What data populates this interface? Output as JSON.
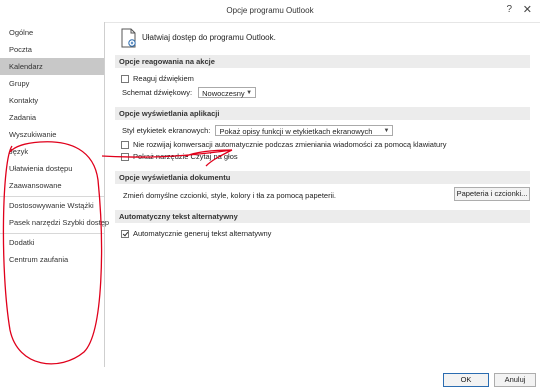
{
  "window": {
    "title": "Opcje programu Outlook",
    "help_glyph": "?",
    "close_glyph": "✕"
  },
  "sidebar": {
    "items": [
      {
        "label": "Ogólne"
      },
      {
        "label": "Poczta"
      },
      {
        "label": "Kalendarz"
      },
      {
        "label": "Grupy"
      },
      {
        "label": "Kontakty"
      },
      {
        "label": "Zadania"
      },
      {
        "label": "Wyszukiwanie"
      },
      {
        "label": "Język"
      },
      {
        "label": "Ułatwienia dostępu"
      },
      {
        "label": "Zaawansowane"
      },
      {
        "label": "Dostosowywanie Wstążki"
      },
      {
        "label": "Pasek narzędzi Szybki dostęp"
      },
      {
        "label": "Dodatki"
      },
      {
        "label": "Centrum zaufania"
      }
    ]
  },
  "main": {
    "header": "Ułatwiaj dostęp do programu Outlook.",
    "sections": {
      "reaction": {
        "title": "Opcje reagowania na akcje",
        "sound_label": "Reaguj dźwiękiem",
        "sound_checked": false,
        "scheme_label": "Schemat dźwiękowy:",
        "scheme_value": "Nowoczesny"
      },
      "display": {
        "title": "Opcje wyświetlania aplikacji",
        "tooltip_label": "Styl etykietek ekranowych:",
        "tooltip_value": "Pokaż opisy funkcji w etykietkach ekranowych",
        "no_collapse_label": "Nie rozwijaj konwersacji automatycznie podczas zmieniania wiadomości za pomocą klawiatury",
        "no_collapse_checked": false,
        "read_aloud_label": "Pokaż narzędzie Czytaj na głos",
        "read_aloud_checked": false
      },
      "document": {
        "title": "Opcje wyświetlania dokumentu",
        "desc": "Zmień domyślne czcionki, style, kolory i tła za pomocą papeterii.",
        "button": "Papeteria i czcionki..."
      },
      "alt_text": {
        "title": "Automatyczny tekst alternatywny",
        "checkbox_label": "Automatycznie generuj tekst alternatywny",
        "checked": true
      }
    }
  },
  "footer": {
    "ok": "OK",
    "cancel": "Anuluj"
  },
  "annotation_color": "#e0001b"
}
